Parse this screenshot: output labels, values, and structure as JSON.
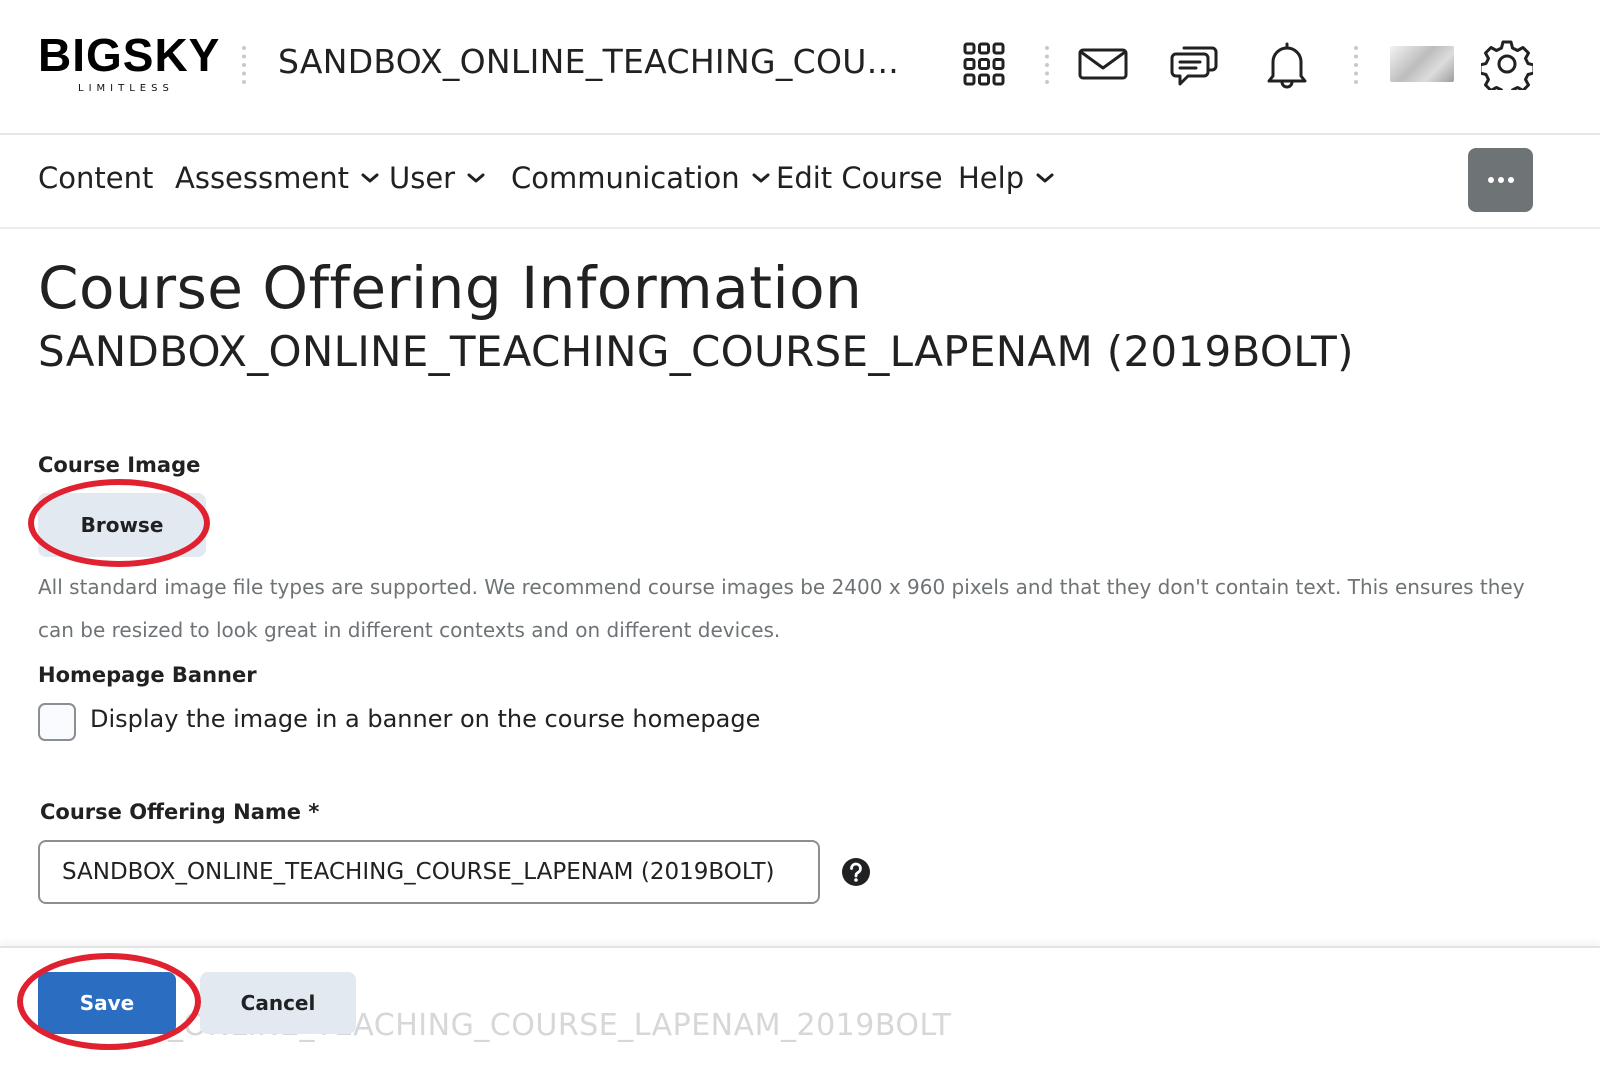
{
  "header": {
    "logo_text": "BigSky",
    "logo_subtext": "Limitless",
    "course_title": "SANDBOX_ONLINE_TEACHING_COU...",
    "icons": [
      "apps-grid-icon",
      "mail-icon",
      "chat-icon",
      "bell-icon",
      "avatar",
      "gear-icon"
    ]
  },
  "nav": {
    "items": [
      {
        "label": "Content",
        "dropdown": false
      },
      {
        "label": "Assessment",
        "dropdown": true
      },
      {
        "label": "User",
        "dropdown": true
      },
      {
        "label": "Communication",
        "dropdown": true
      },
      {
        "label": "Edit Course",
        "dropdown": false
      },
      {
        "label": "Help",
        "dropdown": true
      }
    ],
    "more_icon": "more-dots-icon"
  },
  "main": {
    "title": "Course Offering Information",
    "subtitle": "SANDBOX_ONLINE_TEACHING_COURSE_LAPENAM (2019BOLT)",
    "course_image_label": "Course Image",
    "browse_label": "Browse",
    "image_help_text": "All standard image file types are supported. We recommend course images be 2400 x 960 pixels and that they don't contain text. This ensures they can be resized to look great in different contexts and on different devices.",
    "homepage_banner_label": "Homepage Banner",
    "banner_checkbox_label": "Display the image in a banner on the course homepage",
    "banner_checked": false,
    "offering_name_label": "Course Offering Name *",
    "offering_name_value": "SANDBOX_ONLINE_TEACHING_COURSE_LAPENAM (2019BOLT)"
  },
  "footer": {
    "save_label": "Save",
    "cancel_label": "Cancel",
    "obscured_code_text": "_ONLINE_TEACHING_COURSE_LAPENAM_2019BOLT"
  },
  "colors": {
    "primary_button": "#2a6dc1",
    "secondary_button": "#e3e9f1",
    "annotation_ring": "#e0212f",
    "text": "#202122",
    "muted_text": "#6e7376"
  }
}
